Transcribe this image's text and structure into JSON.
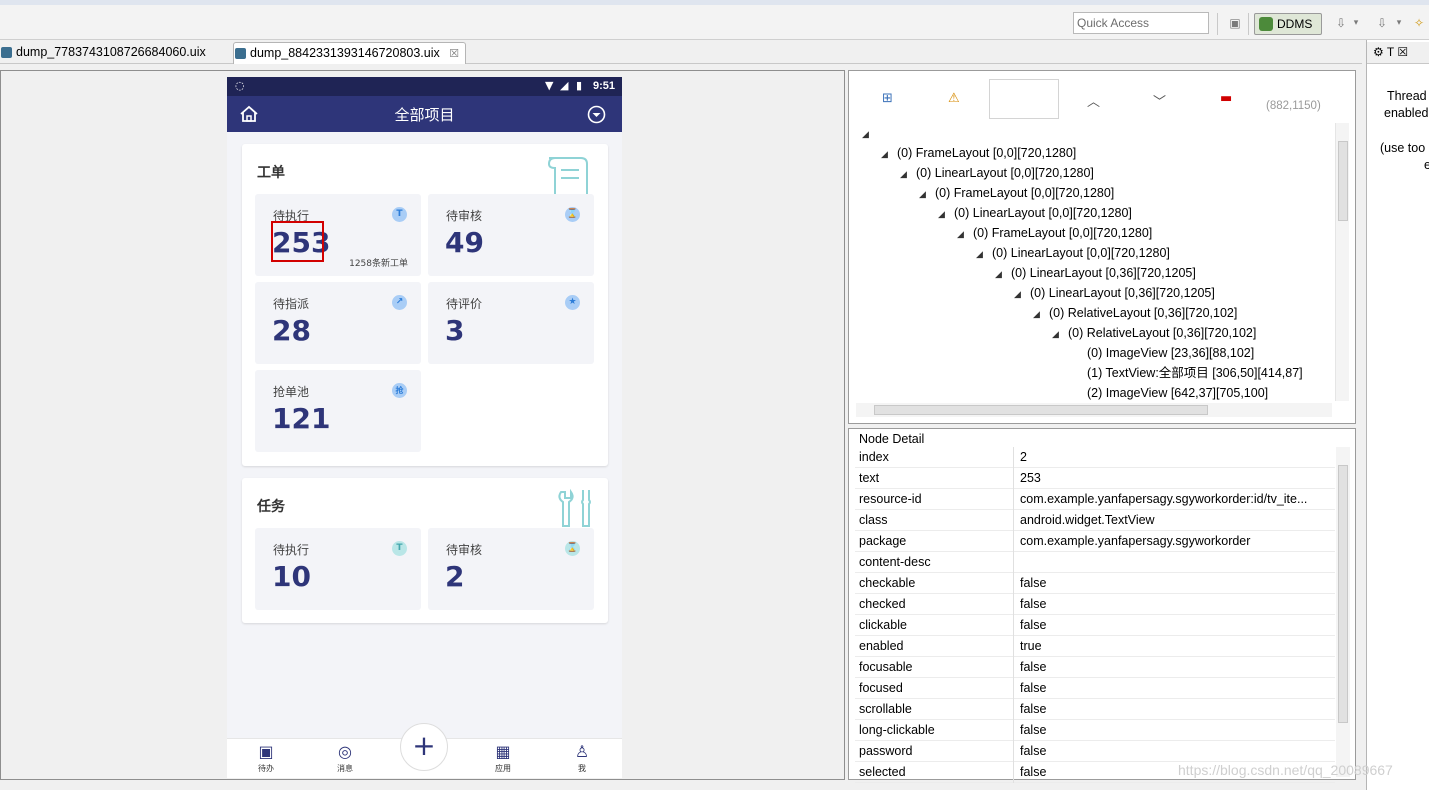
{
  "toolbar": {
    "quick_access_placeholder": "Quick Access",
    "ddms_label": "DDMS"
  },
  "editor_tabs": [
    {
      "label": "dump_7783743108726684060.uix"
    },
    {
      "label": "dump_8842331393146720803.uix",
      "close": "☒"
    }
  ],
  "phone": {
    "status_time": "9:51",
    "app_title": "全部项目",
    "workorder": {
      "title": "工单",
      "cells": [
        {
          "label": "待执行",
          "value": "253",
          "sub": "1258条新工单",
          "badge": "T"
        },
        {
          "label": "待审核",
          "value": "49",
          "badge": "⌛"
        },
        {
          "label": "待指派",
          "value": "28",
          "badge": "↗"
        },
        {
          "label": "待评价",
          "value": "3",
          "badge": "★"
        },
        {
          "label": "抢单池",
          "value": "121",
          "badge": "抢"
        }
      ]
    },
    "task": {
      "title": "任务",
      "cells": [
        {
          "label": "待执行",
          "value": "10",
          "badge": "T"
        },
        {
          "label": "待审核",
          "value": "2",
          "badge": "⌛"
        }
      ]
    },
    "nav": [
      {
        "label": "待办",
        "icon": "todo-icon"
      },
      {
        "label": "消息",
        "icon": "message-icon"
      },
      {
        "label": "应用",
        "icon": "apps-icon"
      },
      {
        "label": "我",
        "icon": "user-icon"
      }
    ],
    "plus": "+"
  },
  "hierarchy": {
    "coord": "(882,1150)",
    "nodes": [
      {
        "text": "(0) FrameLayout [0,0][720,1280]",
        "depth": 1,
        "expanded": true
      },
      {
        "text": "(0) LinearLayout [0,0][720,1280]",
        "depth": 2,
        "expanded": true
      },
      {
        "text": "(0) FrameLayout [0,0][720,1280]",
        "depth": 3,
        "expanded": true
      },
      {
        "text": "(0) LinearLayout [0,0][720,1280]",
        "depth": 4,
        "expanded": true
      },
      {
        "text": "(0) FrameLayout [0,0][720,1280]",
        "depth": 5,
        "expanded": true
      },
      {
        "text": "(0) LinearLayout [0,0][720,1280]",
        "depth": 6,
        "expanded": true
      },
      {
        "text": "(0) LinearLayout [0,36][720,1205]",
        "depth": 7,
        "expanded": true
      },
      {
        "text": "(0) LinearLayout [0,36][720,1205]",
        "depth": 8,
        "expanded": true
      },
      {
        "text": "(0) RelativeLayout [0,36][720,102]",
        "depth": 9,
        "expanded": true
      },
      {
        "text": "(0) RelativeLayout [0,36][720,102]",
        "depth": 10,
        "expanded": true
      },
      {
        "text": "(0) ImageView [23,36][88,102]",
        "depth": 11,
        "expanded": false
      },
      {
        "text": "(1) TextView:全部项目 [306,50][414,87]",
        "depth": 11,
        "expanded": false
      },
      {
        "text": "(2) ImageView [642,37][705,100]",
        "depth": 11,
        "expanded": false
      }
    ]
  },
  "node_detail": {
    "title": "Node Detail",
    "rows": [
      {
        "key": "index",
        "value": "2"
      },
      {
        "key": "text",
        "value": "253"
      },
      {
        "key": "resource-id",
        "value": "com.example.yanfapersagy.sgyworkorder:id/tv_ite..."
      },
      {
        "key": "class",
        "value": "android.widget.TextView"
      },
      {
        "key": "package",
        "value": "com.example.yanfapersagy.sgyworkorder"
      },
      {
        "key": "content-desc",
        "value": ""
      },
      {
        "key": "checkable",
        "value": "false"
      },
      {
        "key": "checked",
        "value": "false"
      },
      {
        "key": "clickable",
        "value": "false"
      },
      {
        "key": "enabled",
        "value": "true"
      },
      {
        "key": "focusable",
        "value": "false"
      },
      {
        "key": "focused",
        "value": "false"
      },
      {
        "key": "scrollable",
        "value": "false"
      },
      {
        "key": "long-clickable",
        "value": "false"
      },
      {
        "key": "password",
        "value": "false"
      },
      {
        "key": "selected",
        "value": "false"
      }
    ]
  },
  "side_panel": {
    "tab_label": "T",
    "lines": [
      "Thread",
      "enabled",
      "(use too",
      "e"
    ]
  },
  "watermark": "https://blog.csdn.net/qq_20089667"
}
